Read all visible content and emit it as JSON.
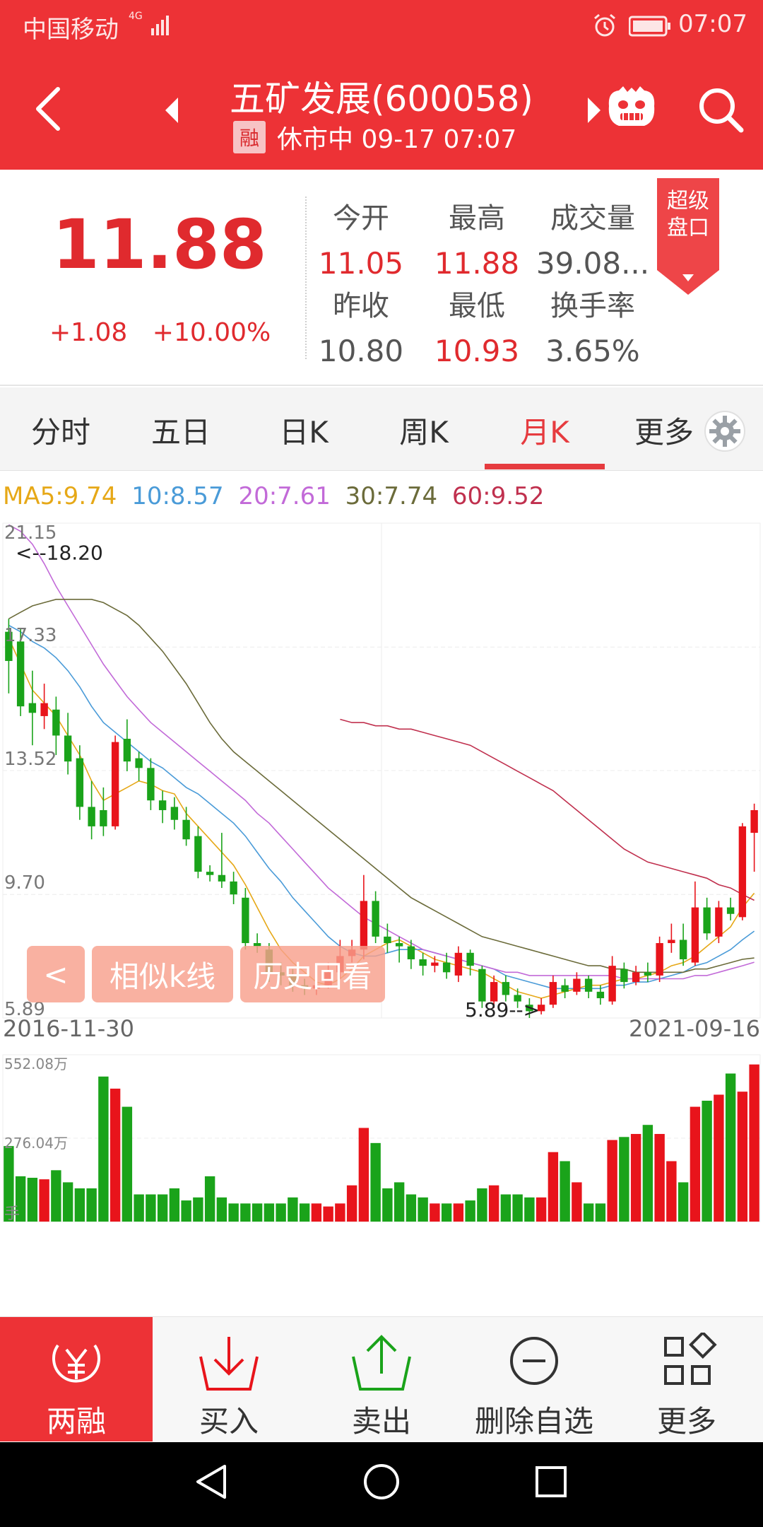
{
  "status_bar": {
    "carrier": "中国移动",
    "network": "4G",
    "time": "07:07"
  },
  "header": {
    "title": "五矿发展(600058)",
    "badge": "融",
    "status": "休市中 09-17 07:07"
  },
  "quote": {
    "price": "11.88",
    "change": "+1.08",
    "change_pct": "+10.00%",
    "stats": {
      "open_label": "今开",
      "open": "11.05",
      "high_label": "最高",
      "high": "11.88",
      "volume_label": "成交量",
      "volume": "39.08...",
      "prev_close_label": "昨收",
      "prev_close": "10.80",
      "low_label": "最低",
      "low": "10.93",
      "turnover_label": "换手率",
      "turnover": "3.65%"
    },
    "super_button": {
      "line1": "超级",
      "line2": "盘口"
    }
  },
  "tabs": [
    "分时",
    "五日",
    "日K",
    "周K",
    "月K",
    "更多"
  ],
  "active_tab": "月K",
  "ma_legend": [
    {
      "label": "MA5:9.74",
      "color": "#e6a817"
    },
    {
      "label": "10:8.57",
      "color": "#4a9bd8"
    },
    {
      "label": "20:7.61",
      "color": "#c26ad8"
    },
    {
      "label": "30:7.74",
      "color": "#6b6b3a"
    },
    {
      "label": "60:9.52",
      "color": "#c0304e"
    }
  ],
  "chart_data": {
    "type": "candlestick",
    "interval": "monthly",
    "x_start": "2016-11-30",
    "x_end": "2021-09-16",
    "y_ticks": [
      "21.15",
      "17.33",
      "13.52",
      "9.70",
      "5.89"
    ],
    "ylim": [
      5.89,
      21.15
    ],
    "annotations": {
      "max_label": "<--18.20",
      "max_value": 18.2,
      "min_label": "5.89-->",
      "min_value": 5.89
    },
    "colors": {
      "up": "#e8141b",
      "down": "#1aa31a"
    },
    "candles": [
      [
        17.8,
        16.9,
        18.2,
        15.9
      ],
      [
        17.5,
        15.5,
        17.9,
        15.2
      ],
      [
        15.6,
        15.3,
        16.6,
        14.3
      ],
      [
        15.2,
        15.6,
        16.2,
        14.8
      ],
      [
        15.4,
        14.6,
        15.8,
        14.0
      ],
      [
        14.6,
        13.8,
        15.3,
        13.4
      ],
      [
        13.9,
        12.4,
        14.3,
        12.0
      ],
      [
        12.4,
        11.8,
        13.2,
        11.4
      ],
      [
        12.3,
        11.8,
        13.0,
        11.5
      ],
      [
        11.8,
        14.4,
        14.6,
        11.7
      ],
      [
        14.5,
        13.8,
        15.1,
        13.5
      ],
      [
        13.9,
        13.6,
        14.1,
        13.2
      ],
      [
        13.6,
        12.6,
        13.9,
        12.3
      ],
      [
        12.6,
        12.3,
        12.9,
        11.9
      ],
      [
        12.4,
        12.0,
        12.7,
        11.7
      ],
      [
        12.0,
        11.4,
        12.4,
        11.2
      ],
      [
        11.5,
        10.4,
        11.8,
        10.2
      ],
      [
        10.4,
        10.3,
        10.6,
        10.1
      ],
      [
        10.3,
        10.1,
        11.6,
        9.9
      ],
      [
        10.1,
        9.7,
        10.4,
        9.4
      ],
      [
        9.6,
        8.2,
        9.9,
        8.0
      ],
      [
        8.2,
        8.1,
        8.5,
        7.9
      ],
      [
        8.0,
        7.3,
        8.2,
        7.0
      ],
      [
        7.3,
        7.2,
        7.6,
        6.9
      ],
      [
        7.2,
        6.9,
        7.4,
        6.7
      ],
      [
        6.9,
        6.8,
        7.1,
        6.6
      ],
      [
        6.8,
        6.9,
        7.1,
        6.6
      ],
      [
        6.9,
        7.3,
        7.6,
        6.8
      ],
      [
        7.3,
        7.8,
        8.3,
        7.1
      ],
      [
        7.8,
        8.0,
        8.3,
        7.6
      ],
      [
        8.0,
        9.5,
        10.3,
        7.7
      ],
      [
        9.5,
        8.4,
        9.8,
        8.2
      ],
      [
        8.4,
        8.2,
        8.8,
        7.9
      ],
      [
        8.2,
        8.1,
        8.4,
        7.6
      ],
      [
        8.1,
        7.7,
        8.3,
        7.4
      ],
      [
        7.7,
        7.5,
        7.9,
        7.2
      ],
      [
        7.5,
        7.6,
        7.8,
        7.3
      ],
      [
        7.6,
        7.3,
        7.9,
        7.1
      ],
      [
        7.2,
        7.9,
        8.1,
        7.0
      ],
      [
        7.9,
        7.5,
        8.0,
        7.2
      ],
      [
        7.4,
        6.4,
        7.5,
        6.2
      ],
      [
        6.4,
        7.0,
        7.2,
        6.2
      ],
      [
        7.0,
        6.6,
        7.2,
        6.4
      ],
      [
        6.6,
        6.4,
        6.8,
        6.2
      ],
      [
        6.3,
        6.1,
        6.5,
        5.89
      ],
      [
        6.1,
        6.3,
        6.5,
        6.0
      ],
      [
        6.3,
        7.0,
        7.2,
        6.2
      ],
      [
        6.9,
        6.7,
        7.1,
        6.5
      ],
      [
        6.7,
        7.1,
        7.3,
        6.6
      ],
      [
        7.1,
        6.7,
        7.2,
        6.5
      ],
      [
        6.7,
        6.5,
        6.9,
        6.3
      ],
      [
        6.4,
        7.5,
        7.8,
        6.3
      ],
      [
        7.4,
        7.0,
        7.6,
        6.8
      ],
      [
        7.0,
        7.3,
        7.5,
        6.9
      ],
      [
        7.3,
        7.2,
        7.6,
        7.0
      ],
      [
        7.2,
        8.2,
        8.4,
        7.0
      ],
      [
        8.2,
        8.3,
        8.8,
        7.9
      ],
      [
        8.3,
        7.7,
        8.8,
        7.5
      ],
      [
        7.6,
        9.3,
        10.1,
        7.5
      ],
      [
        9.3,
        8.5,
        9.6,
        8.3
      ],
      [
        8.4,
        9.3,
        9.5,
        8.2
      ],
      [
        9.3,
        9.1,
        9.6,
        8.9
      ],
      [
        9.0,
        11.8,
        11.9,
        8.9
      ],
      [
        11.6,
        12.3,
        12.5,
        10.4
      ]
    ],
    "ma_lines": [
      {
        "name": "MA5",
        "color": "#e6a817",
        "start": 0,
        "values": [
          17.6,
          16.8,
          16.0,
          15.6,
          15.2,
          14.6,
          14.0,
          13.2,
          12.6,
          12.8,
          13.0,
          13.2,
          13.1,
          12.9,
          12.8,
          12.2,
          11.8,
          11.4,
          11.0,
          10.6,
          10.0,
          9.3,
          8.6,
          8.0,
          7.6,
          7.3,
          7.0,
          6.9,
          7.1,
          7.4,
          7.8,
          8.0,
          8.2,
          8.3,
          8.1,
          7.9,
          7.7,
          7.6,
          7.5,
          7.4,
          7.3,
          7.1,
          6.9,
          6.7,
          6.6,
          6.5,
          6.6,
          6.7,
          6.8,
          6.9,
          6.9,
          7.0,
          7.1,
          7.1,
          7.2,
          7.3,
          7.5,
          7.6,
          7.8,
          8.1,
          8.4,
          8.7,
          9.3,
          9.74
        ]
      },
      {
        "name": "MA10",
        "color": "#4a9bd8",
        "start": 0,
        "values": [
          18.0,
          17.8,
          17.5,
          17.3,
          17.0,
          16.6,
          16.1,
          15.5,
          15.0,
          14.7,
          14.4,
          14.1,
          13.8,
          13.6,
          13.3,
          13.0,
          12.8,
          12.5,
          12.2,
          11.9,
          11.5,
          11.0,
          10.5,
          10.1,
          9.6,
          9.2,
          8.8,
          8.4,
          8.1,
          7.9,
          7.8,
          7.8,
          7.9,
          8.0,
          8.0,
          8.0,
          7.9,
          7.8,
          7.7,
          7.6,
          7.5,
          7.4,
          7.2,
          7.1,
          7.0,
          6.9,
          6.8,
          6.8,
          6.8,
          6.8,
          6.8,
          6.9,
          6.9,
          7.0,
          7.0,
          7.1,
          7.2,
          7.3,
          7.5,
          7.6,
          7.8,
          8.0,
          8.3,
          8.57
        ]
      },
      {
        "name": "MA20",
        "color": "#c26ad8",
        "start": 0,
        "values": [
          21.1,
          20.9,
          20.5,
          19.9,
          19.2,
          18.6,
          18.0,
          17.4,
          16.8,
          16.3,
          15.8,
          15.4,
          15.0,
          14.7,
          14.4,
          14.1,
          13.8,
          13.5,
          13.2,
          12.9,
          12.6,
          12.2,
          11.9,
          11.5,
          11.1,
          10.7,
          10.3,
          9.9,
          9.6,
          9.3,
          9.0,
          8.8,
          8.6,
          8.4,
          8.2,
          8.0,
          7.9,
          7.8,
          7.7,
          7.6,
          7.5,
          7.4,
          7.3,
          7.3,
          7.2,
          7.2,
          7.2,
          7.2,
          7.2,
          7.2,
          7.2,
          7.2,
          7.1,
          7.1,
          7.1,
          7.1,
          7.1,
          7.1,
          7.2,
          7.2,
          7.3,
          7.4,
          7.5,
          7.61
        ]
      },
      {
        "name": "MA30",
        "color": "#6b6b3a",
        "start": 0,
        "values": [
          18.2,
          18.4,
          18.6,
          18.7,
          18.8,
          18.8,
          18.8,
          18.8,
          18.7,
          18.5,
          18.3,
          18.0,
          17.6,
          17.2,
          16.7,
          16.2,
          15.6,
          15.0,
          14.5,
          14.1,
          13.8,
          13.5,
          13.2,
          12.9,
          12.6,
          12.3,
          12.0,
          11.7,
          11.4,
          11.1,
          10.8,
          10.5,
          10.2,
          9.9,
          9.6,
          9.4,
          9.2,
          9.0,
          8.8,
          8.6,
          8.4,
          8.3,
          8.2,
          8.1,
          8.0,
          7.9,
          7.8,
          7.7,
          7.6,
          7.5,
          7.5,
          7.4,
          7.4,
          7.3,
          7.3,
          7.3,
          7.3,
          7.3,
          7.4,
          7.4,
          7.5,
          7.6,
          7.7,
          7.74
        ]
      },
      {
        "name": "MA60",
        "color": "#c0304e",
        "start": 28,
        "values": [
          15.1,
          15.0,
          15.0,
          14.9,
          14.9,
          14.8,
          14.8,
          14.7,
          14.6,
          14.5,
          14.4,
          14.3,
          14.1,
          13.9,
          13.7,
          13.5,
          13.3,
          13.1,
          12.9,
          12.6,
          12.3,
          12.0,
          11.7,
          11.4,
          11.1,
          10.9,
          10.7,
          10.6,
          10.5,
          10.4,
          10.3,
          10.2,
          10.0,
          9.9,
          9.7,
          9.52
        ]
      }
    ],
    "volume": {
      "ticks": [
        "552.08万",
        "276.04万"
      ],
      "ymax": 552.08,
      "unit_label": "手",
      "values": [
        250,
        150,
        145,
        140,
        170,
        130,
        110,
        110,
        480,
        440,
        380,
        90,
        90,
        90,
        110,
        70,
        80,
        150,
        80,
        60,
        60,
        60,
        60,
        60,
        80,
        60,
        60,
        50,
        60,
        120,
        310,
        260,
        110,
        130,
        90,
        80,
        60,
        60,
        60,
        70,
        110,
        120,
        90,
        90,
        80,
        80,
        230,
        200,
        130,
        60,
        60,
        270,
        280,
        290,
        320,
        290,
        200,
        130,
        380,
        400,
        420,
        490,
        430,
        520
      ]
    }
  },
  "chart_controls": {
    "back": "<",
    "similar": "相似k线",
    "history": "历史回看"
  },
  "toolbar": [
    {
      "label": "两融",
      "icon": "rmb-margin-icon",
      "active": true
    },
    {
      "label": "买入",
      "icon": "buy-download-icon",
      "active": false
    },
    {
      "label": "卖出",
      "icon": "sell-upload-icon",
      "active": false
    },
    {
      "label": "删除自选",
      "icon": "remove-watchlist-icon",
      "active": false
    },
    {
      "label": "更多",
      "icon": "more-grid-icon",
      "active": false
    }
  ]
}
